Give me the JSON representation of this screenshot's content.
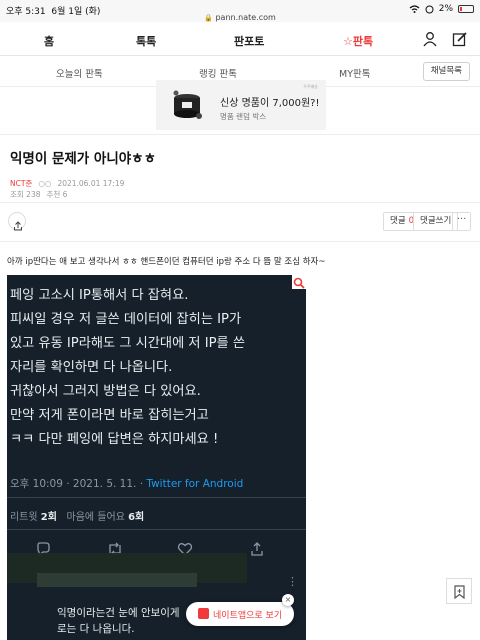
{
  "status_bar": {
    "time": "오후 5:31",
    "date": "6월 1일 (화)",
    "url": "pann.nate.com",
    "battery": "2%"
  },
  "nav": {
    "items": [
      "홈",
      "톡톡",
      "판포토",
      "☆판톡"
    ],
    "icons": [
      "user-icon",
      "edit-icon"
    ],
    "active_color": "#ef3b3b"
  },
  "subnav": {
    "items": [
      "오늘의 판톡",
      "랭킹 판톡",
      "MY판톡"
    ],
    "channel_button": "채널목록"
  },
  "ad": {
    "title": "신상 명품이 7,000원?!",
    "subtitle": "명품 랜덤 박스",
    "label": "우주배송"
  },
  "post": {
    "title": "익명이 문제가 아니야ㅎㅎ",
    "author": "NCT준",
    "dots": "○○",
    "datetime": "2021.06.01 17:19",
    "views": "조회 238",
    "likes": "추천 6",
    "body": "아까 ip딴다는 애 보고 생각나서 ㅎㅎ 핸드폰이던 컴퓨터던 ip랑 주소 다 뜸 말 조심 하자~"
  },
  "actions": {
    "comments_label": "댓글",
    "comments_count": "0",
    "write_comment": "댓글쓰기",
    "more": "···"
  },
  "tweet": {
    "lines": [
      "페잉 고소시 IP통해서 다 잡혀요.",
      "피씨일 경우 저 글쓴 데이터에 잡히는 IP가",
      "있고 유동 IP라해도 그 시간대에 저 IP를 쓴",
      "자리를 확인하면 다 나옵니다.",
      "귀찮아서 그러지 방법은 다 있어요.",
      "만약 저게 폰이라면 바로 잡히는거고",
      "ㅋㅋ 다만 페잉에 답변은 하지마세요 !"
    ],
    "date": "오후 10:09 · 2021. 5. 11. · ",
    "source": "Twitter for Android",
    "retweets_label": "리트윗",
    "retweets_count": "2회",
    "likes_label": "마음에 들어요",
    "likes_count": "6회",
    "reply_lines": [
      "익명이라는건 눈에 안보이게",
      "로는 다 나옵니다."
    ]
  },
  "promo": {
    "label": "네이트앱으로 보기",
    "close": "×"
  }
}
